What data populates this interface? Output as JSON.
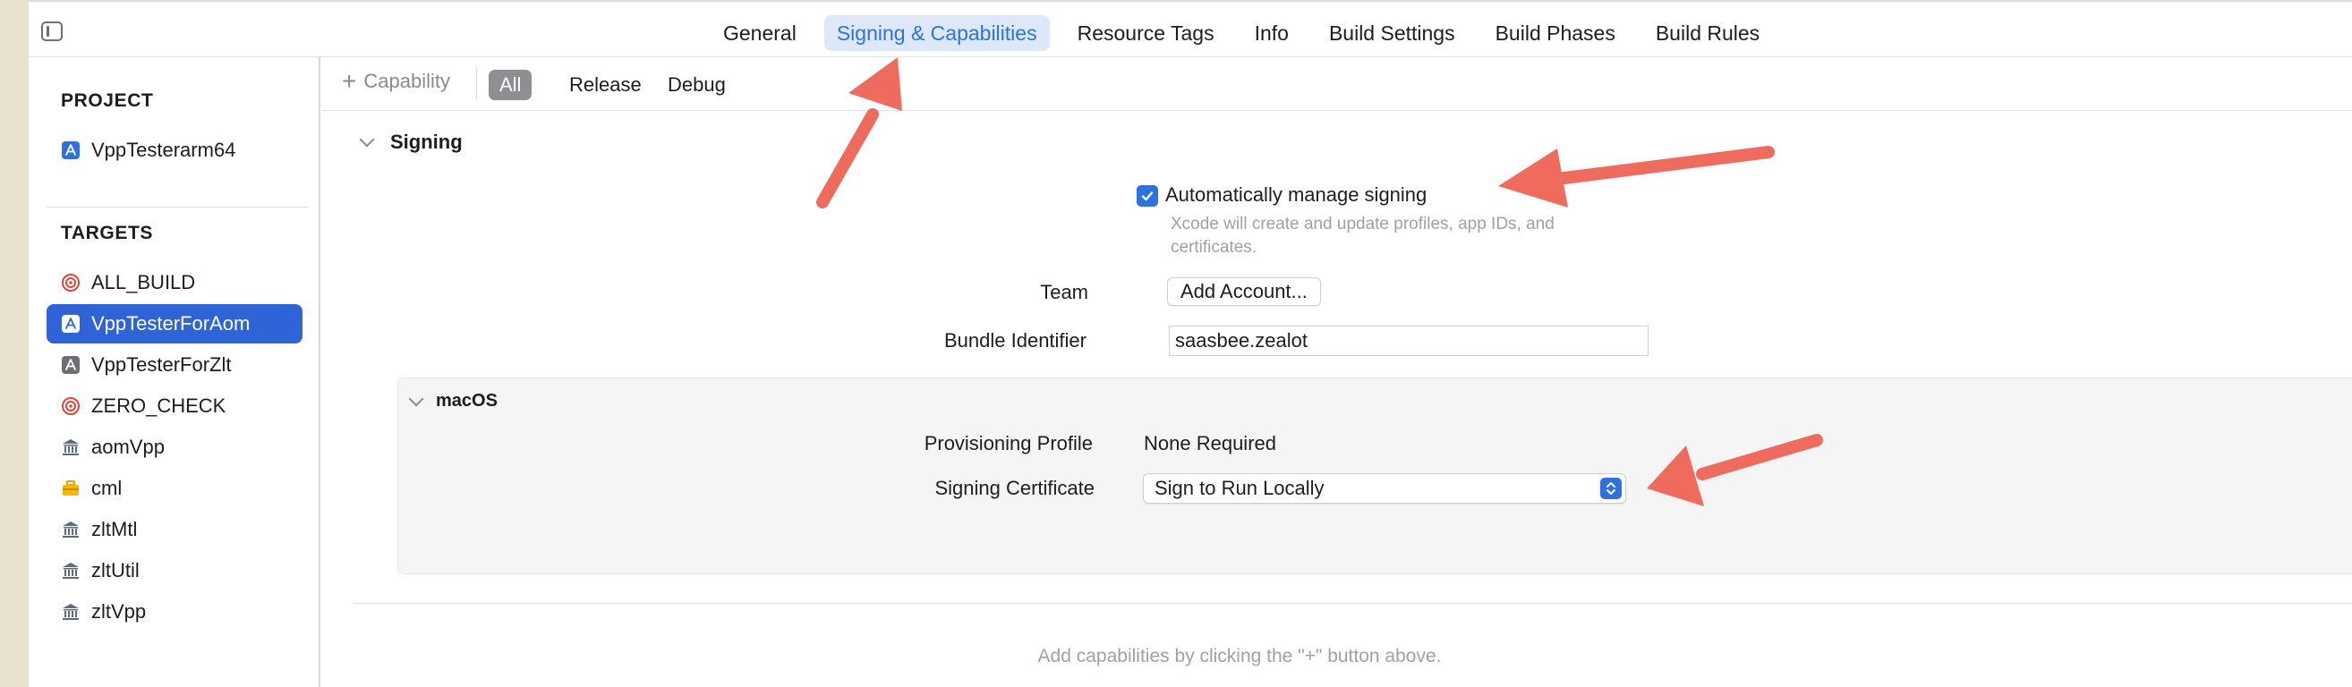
{
  "topbar": {
    "tabs": [
      {
        "label": "General",
        "active": false
      },
      {
        "label": "Signing & Capabilities",
        "active": true
      },
      {
        "label": "Resource Tags",
        "active": false
      },
      {
        "label": "Info",
        "active": false
      },
      {
        "label": "Build Settings",
        "active": false
      },
      {
        "label": "Build Phases",
        "active": false
      },
      {
        "label": "Build Rules",
        "active": false
      }
    ]
  },
  "sidebar": {
    "project_title": "PROJECT",
    "project": {
      "label": "VppTesterarm64",
      "icon": "app-icon"
    },
    "targets_title": "TARGETS",
    "targets": [
      {
        "label": "ALL_BUILD",
        "icon": "target-icon",
        "selected": false
      },
      {
        "label": "VppTesterForAom",
        "icon": "app-icon",
        "selected": true
      },
      {
        "label": "VppTesterForZlt",
        "icon": "app-icon",
        "selected": false
      },
      {
        "label": "ZERO_CHECK",
        "icon": "target-icon",
        "selected": false
      },
      {
        "label": "aomVpp",
        "icon": "library-icon",
        "selected": false
      },
      {
        "label": "cml",
        "icon": "toolbox-icon",
        "selected": false
      },
      {
        "label": "zltMtl",
        "icon": "library-icon",
        "selected": false
      },
      {
        "label": "zltUtil",
        "icon": "library-icon",
        "selected": false
      },
      {
        "label": "zltVpp",
        "icon": "library-icon",
        "selected": false
      }
    ]
  },
  "capabilities": {
    "add_label": "Capability",
    "filters": [
      {
        "label": "All",
        "active": true
      },
      {
        "label": "Release",
        "active": false
      },
      {
        "label": "Debug",
        "active": false
      }
    ]
  },
  "signing": {
    "title": "Signing",
    "auto_manage_label": "Automatically manage signing",
    "auto_manage_checked": true,
    "auto_manage_desc": "Xcode will create and update profiles, app IDs, and certificates.",
    "team_label": "Team",
    "team_button": "Add Account...",
    "bundle_label": "Bundle Identifier",
    "bundle_value": "saasbee.zealot",
    "macos": {
      "title": "macOS",
      "profile_label": "Provisioning Profile",
      "profile_value": "None Required",
      "cert_label": "Signing Certificate",
      "cert_value": "Sign to Run Locally"
    }
  },
  "hint": "Add capabilities by clicking the \"+\" button above.",
  "colors": {
    "accent": "#2f71e0",
    "selected_row": "#2f64d9",
    "annotation_arrow": "#ee6b5e"
  }
}
